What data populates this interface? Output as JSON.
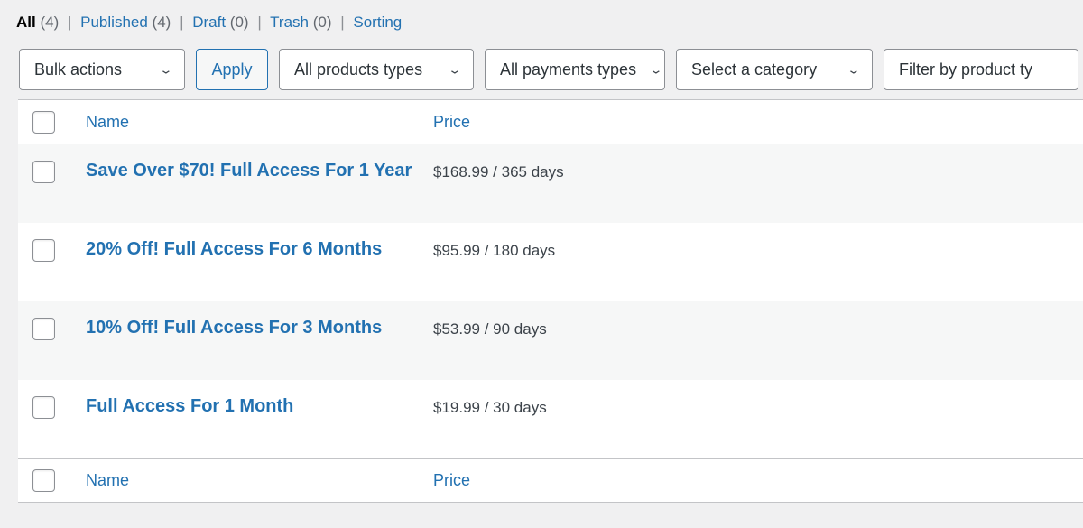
{
  "status_filters": [
    {
      "label": "All",
      "count": "(4)",
      "current": true
    },
    {
      "label": "Published",
      "count": "(4)",
      "current": false
    },
    {
      "label": "Draft",
      "count": "(0)",
      "current": false
    },
    {
      "label": "Trash",
      "count": "(0)",
      "current": false
    },
    {
      "label": "Sorting",
      "count": "",
      "current": false
    }
  ],
  "separator": "|",
  "toolbar": {
    "bulk_actions_label": "Bulk actions",
    "apply_label": "Apply",
    "product_types_label": "All products types",
    "payment_types_label": "All payments types",
    "category_label": "Select a category",
    "filter_product_label": "Filter by product ty",
    "chevron": "⌄"
  },
  "table": {
    "columns": {
      "name": "Name",
      "price": "Price"
    },
    "rows": [
      {
        "name": "Save Over $70! Full Access For 1 Year",
        "price": "$168.99 / 365 days"
      },
      {
        "name": "20% Off! Full Access For 6 Months",
        "price": "$95.99 / 180 days"
      },
      {
        "name": "10% Off! Full Access For 3 Months",
        "price": "$53.99 / 90 days"
      },
      {
        "name": "Full Access For 1 Month",
        "price": "$19.99 / 30 days"
      }
    ]
  },
  "colors": {
    "link": "#2271b1",
    "text": "#3c434a",
    "muted": "#646970",
    "page_bg": "#f0f0f1",
    "stripe": "#f6f7f7",
    "border": "#c3c4c7"
  }
}
